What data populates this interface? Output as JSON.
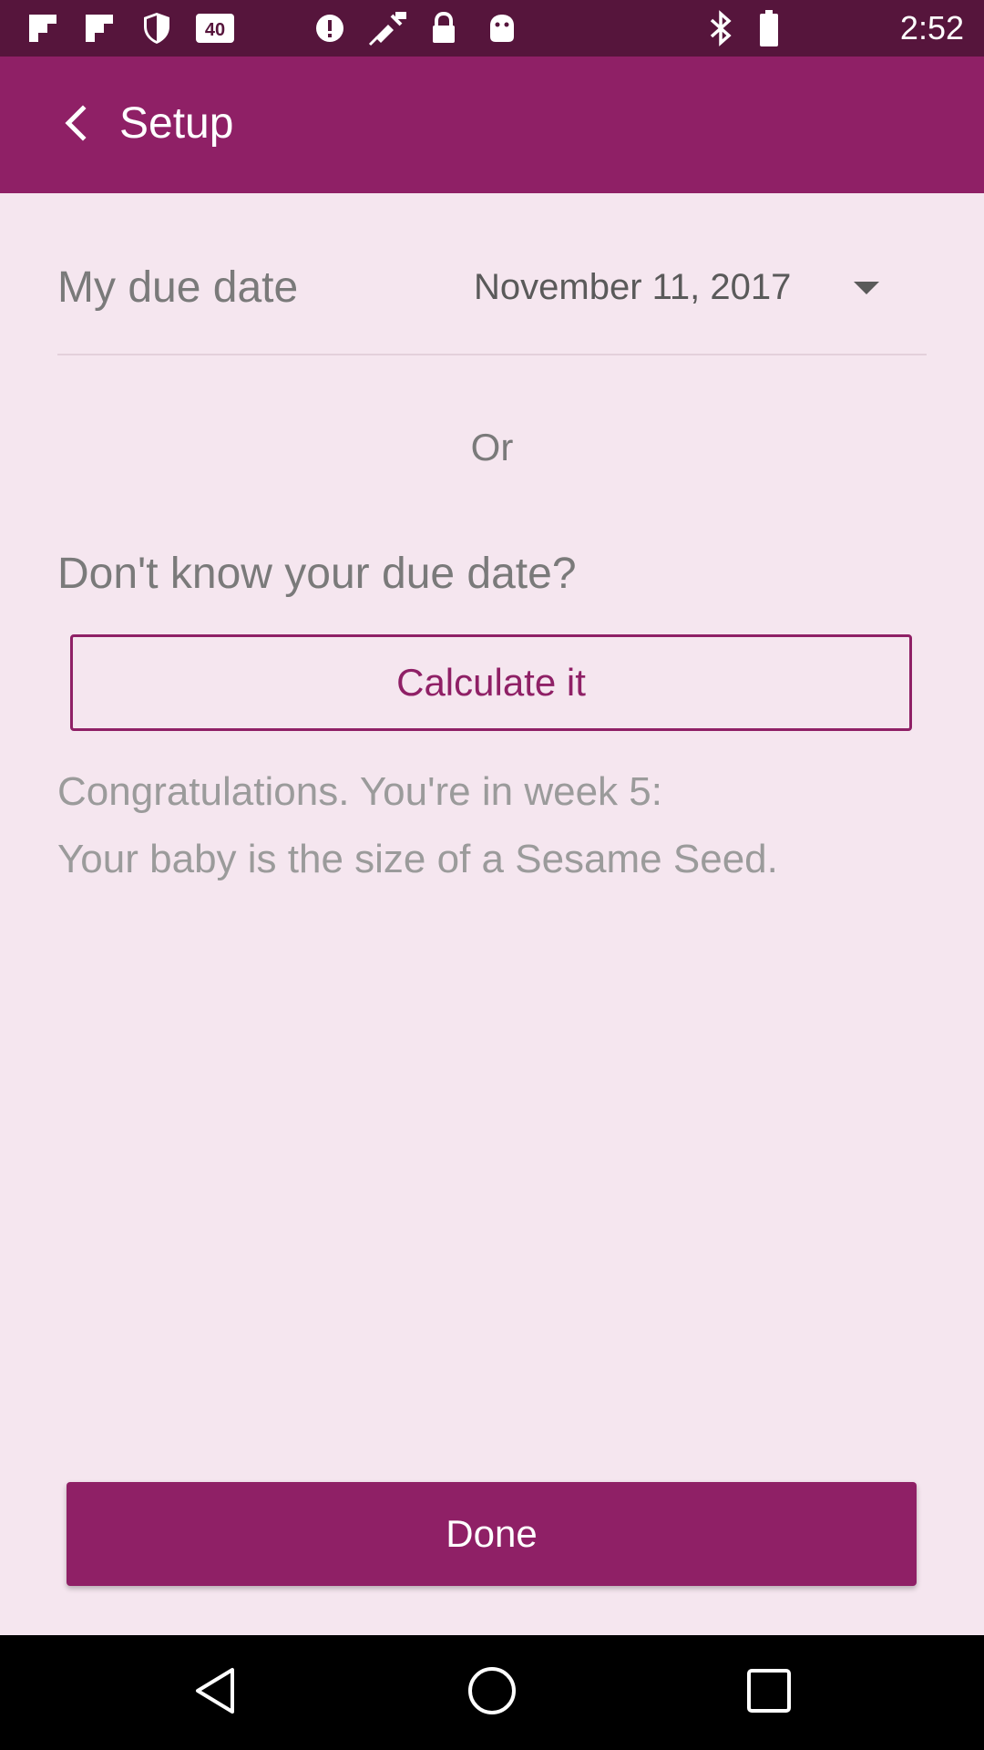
{
  "status_bar": {
    "time": "2:52",
    "icons": [
      "flipboard-icon",
      "flipboard-icon",
      "shield-icon",
      "badge-40-icon",
      "alert-circle-icon",
      "satellite-icon",
      "lock-icon",
      "android-icon",
      "bluetooth-icon",
      "battery-icon"
    ],
    "badge_text": "40"
  },
  "app_bar": {
    "title": "Setup",
    "background": "#8f2066"
  },
  "due_date": {
    "label": "My due date",
    "value": "November 11, 2017"
  },
  "or_text": "Or",
  "dont_know": {
    "question": "Don't know your due date?",
    "button_label": "Calculate it"
  },
  "result": {
    "week_text": "Congratulations. You're in week 5:",
    "size_text": "Your baby is the size of a Sesame Seed."
  },
  "done_label": "Done",
  "colors": {
    "accent": "#8f2066",
    "status_bar": "#56153c",
    "background": "#f5e6ef"
  }
}
